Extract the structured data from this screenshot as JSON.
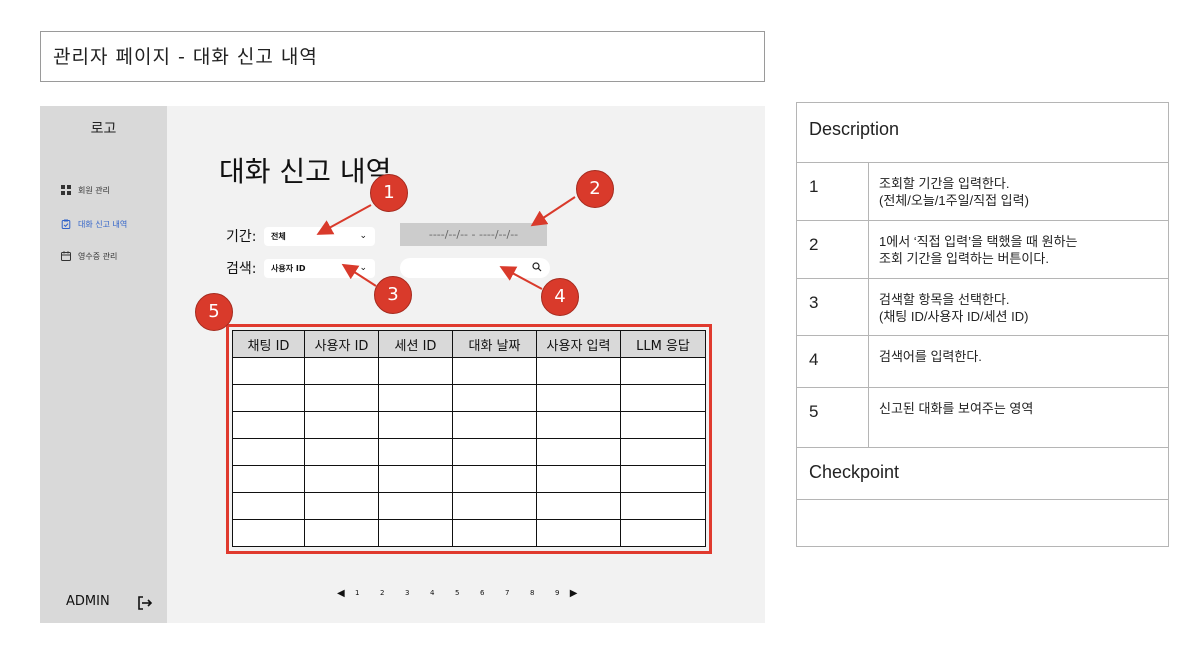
{
  "page_header": "관리자 페이지 - 대화 신고 내역",
  "sidebar": {
    "logo": "로고",
    "items": [
      {
        "label": "회원 관리",
        "icon": "grid-icon",
        "active": false
      },
      {
        "label": "대화 신고 내역",
        "icon": "clipboard-check-icon",
        "active": true
      },
      {
        "label": "영수증 관리",
        "icon": "calendar-icon",
        "active": false
      }
    ],
    "admin_label": "ADMIN",
    "logout_icon": "logout-icon"
  },
  "main": {
    "title": "대화 신고 내역",
    "period_label": "기간:",
    "period_select": "전체",
    "date_range_placeholder": "----/--/-- - ----/--/--",
    "search_label": "검색:",
    "search_select": "사용자 ID",
    "search_placeholder": ""
  },
  "table": {
    "columns": [
      "채팅 ID",
      "사용자 ID",
      "세션 ID",
      "대화 날짜",
      "사용자 입력",
      "LLM 응답"
    ],
    "rows": [
      [
        "",
        "",
        "",
        "",
        "",
        ""
      ],
      [
        "",
        "",
        "",
        "",
        "",
        ""
      ],
      [
        "",
        "",
        "",
        "",
        "",
        ""
      ],
      [
        "",
        "",
        "",
        "",
        "",
        ""
      ],
      [
        "",
        "",
        "",
        "",
        "",
        ""
      ],
      [
        "",
        "",
        "",
        "",
        "",
        ""
      ],
      [
        "",
        "",
        "",
        "",
        "",
        ""
      ]
    ]
  },
  "pagination": {
    "prev": "◀",
    "pages": [
      "1",
      "2",
      "3",
      "4",
      "5",
      "6",
      "7",
      "8",
      "9"
    ],
    "next": "▶"
  },
  "callouts": [
    "1",
    "2",
    "3",
    "4",
    "5"
  ],
  "description": {
    "title": "Description",
    "rows": [
      {
        "num": "1",
        "text": "조회할 기간을 입력한다.\n(전체/오늘/1주일/직접 입력)"
      },
      {
        "num": "2",
        "text": "1에서 ‘직접 입력’을 택했을 때 원하는\n조회 기간을 입력하는 버튼이다."
      },
      {
        "num": "3",
        "text": "검색할 항목을 선택한다.\n(채팅 ID/사용자 ID/세션 ID)"
      },
      {
        "num": "4",
        "text": "검색어를 입력한다."
      },
      {
        "num": "5",
        "text": "신고된 대화를 보여주는 영역"
      }
    ],
    "checkpoint_title": "Checkpoint",
    "checkpoint_text": ""
  },
  "colors": {
    "accent_red": "#d93a2b",
    "active_nav": "#2f62c9",
    "sidebar_bg": "#d9d9d9"
  }
}
